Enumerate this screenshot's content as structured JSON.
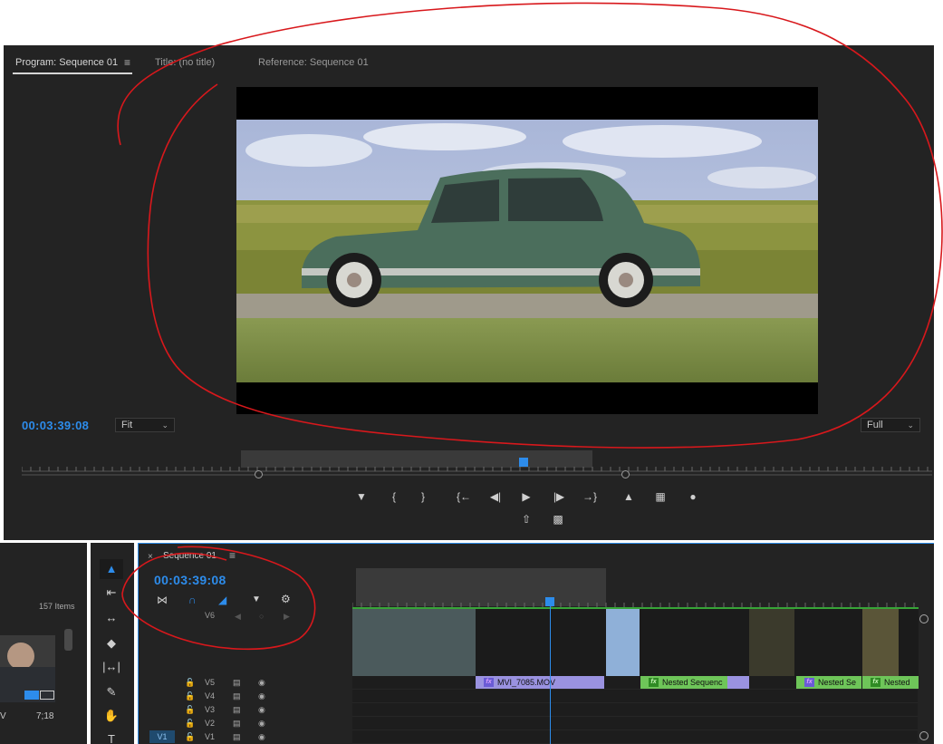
{
  "program_monitor": {
    "tabs": [
      {
        "label": "Program: Sequence 01",
        "active": true
      },
      {
        "label": "Title: (no title)",
        "active": false
      },
      {
        "label": "Reference: Sequence 01",
        "active": false
      }
    ],
    "menu_icon": "hamburger-menu-icon",
    "timecode": "00:03:39:08",
    "fit_select": "Fit",
    "quality_select": "Full",
    "transport_buttons": [
      "add-marker-icon",
      "mark-in-icon",
      "mark-out-icon",
      "go-to-in-icon",
      "step-back-icon",
      "play-icon",
      "step-forward-icon",
      "go-to-out-icon",
      "lift-icon",
      "extract-icon",
      "export-frame-icon"
    ],
    "secondary_buttons": [
      "insert-icon",
      "multicam-icon"
    ]
  },
  "project_panel": {
    "item_count": "157 Items",
    "thumbnail_duration": "7;18",
    "thumbnail_prefix": "V"
  },
  "tools": [
    "selection-tool-icon",
    "track-select-tool-icon",
    "ripple-edit-tool-icon",
    "razor-tool-icon",
    "slip-tool-icon",
    "pen-tool-icon",
    "hand-tool-icon",
    "type-tool-icon"
  ],
  "timeline": {
    "close_label": "×",
    "sequence_name": "Sequence 01",
    "menu_icon": "hamburger-menu-icon",
    "timecode": "00:03:39:08",
    "header_icons": [
      "nest-icon",
      "snap-magnet-icon",
      "linked-selection-icon",
      "add-marker-icon",
      "settings-wrench-icon"
    ],
    "track_target": "V6",
    "tracks": [
      {
        "label": "V5",
        "target": ""
      },
      {
        "label": "V4",
        "target": ""
      },
      {
        "label": "V3",
        "target": ""
      },
      {
        "label": "V2",
        "target": ""
      },
      {
        "label": "V1",
        "target": "V1"
      }
    ],
    "clips": [
      {
        "name": "MVI_7085.MOV",
        "color": "purple"
      },
      {
        "name": "Nested Sequenc",
        "color": "green"
      },
      {
        "name": "Nested Se",
        "color": "purple"
      },
      {
        "name": "Nested",
        "color": "green"
      }
    ]
  },
  "colors": {
    "accent": "#2d8ceb",
    "panel_bg": "#232323",
    "annotation": "#e02020",
    "clip_purple": "#9a92e0",
    "clip_green": "#6ec559"
  }
}
